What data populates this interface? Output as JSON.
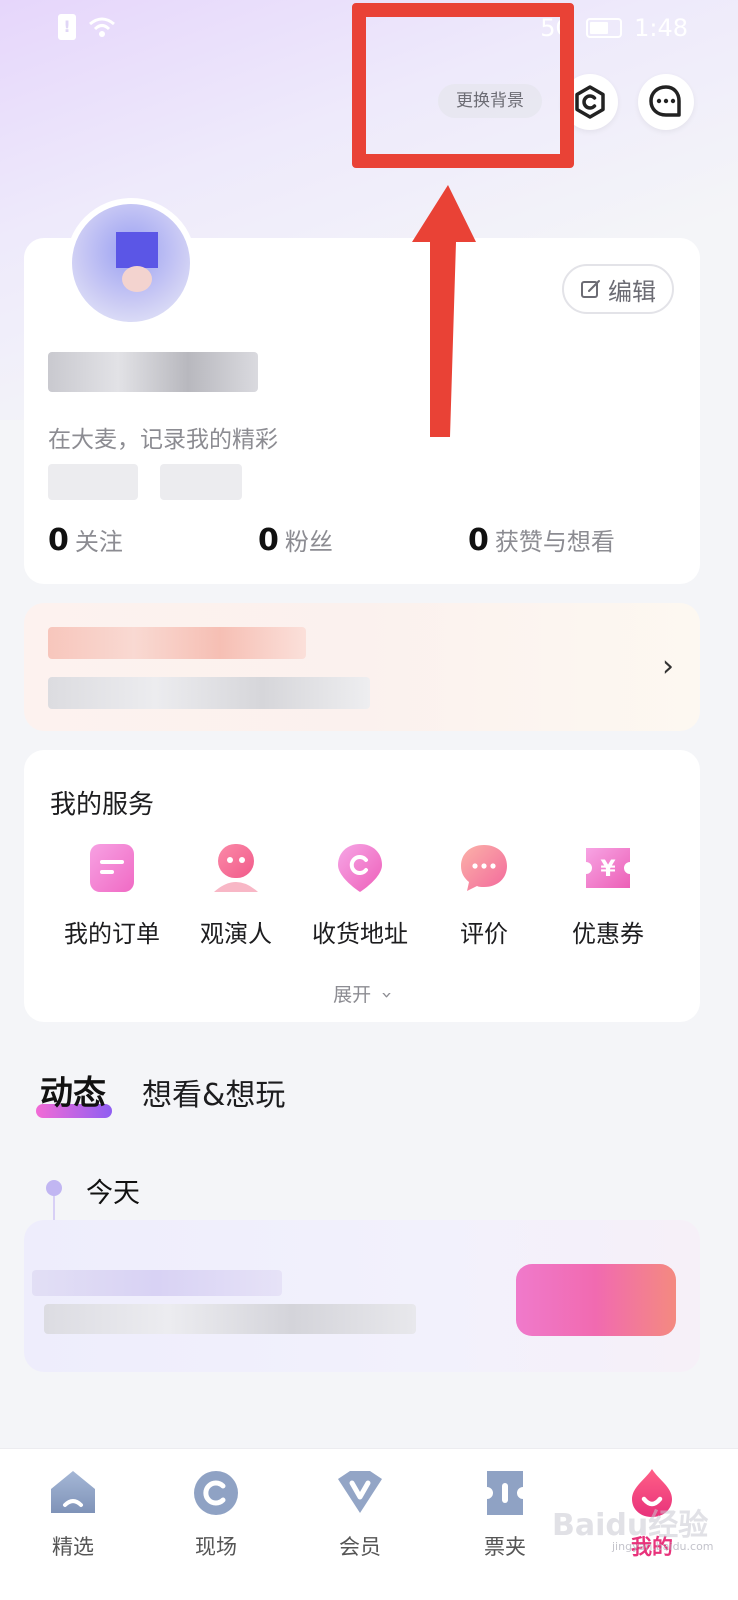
{
  "status_bar": {
    "signal_text": "5G",
    "time": "1:48"
  },
  "header": {
    "change_background_label": "更换背景"
  },
  "profile": {
    "edit_label": "编辑",
    "tagline": "在大麦，记录我的精彩",
    "stats": [
      {
        "count": "0",
        "label": "关注"
      },
      {
        "count": "0",
        "label": "粉丝"
      },
      {
        "count": "0",
        "label": "获赞与想看"
      }
    ]
  },
  "services": {
    "title": "我的服务",
    "items": [
      {
        "label": "我的订单",
        "icon": "order-icon"
      },
      {
        "label": "观演人",
        "icon": "audience-icon"
      },
      {
        "label": "收货地址",
        "icon": "address-icon"
      },
      {
        "label": "评价",
        "icon": "review-icon"
      },
      {
        "label": "优惠券",
        "icon": "coupon-icon"
      }
    ],
    "expand_label": "展开"
  },
  "feed": {
    "tabs": [
      {
        "label": "动态",
        "active": true
      },
      {
        "label": "想看&想玩",
        "active": false
      }
    ],
    "today_label": "今天"
  },
  "bottom_nav": {
    "items": [
      {
        "label": "精选",
        "icon": "home-icon"
      },
      {
        "label": "现场",
        "icon": "live-icon"
      },
      {
        "label": "会员",
        "icon": "vip-icon"
      },
      {
        "label": "票夹",
        "icon": "ticket-icon"
      },
      {
        "label": "我的",
        "icon": "profile-icon"
      }
    ]
  },
  "watermark": {
    "text": "Baidu经验",
    "subtext": "jingyan.baidu.com"
  },
  "colors": {
    "accent": "#e8327b",
    "annotation_red": "#e94236",
    "tab_gradient_start": "#f26bd6",
    "tab_gradient_end": "#8f5ef2"
  }
}
